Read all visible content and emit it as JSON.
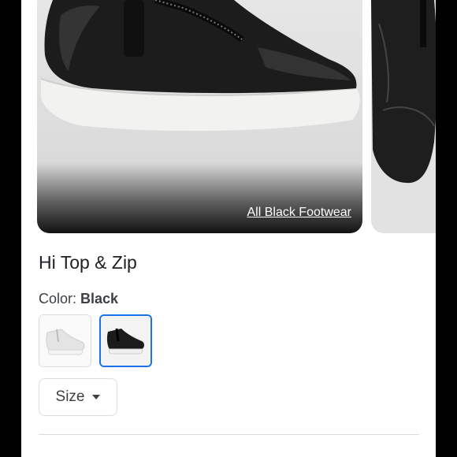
{
  "hero": {
    "link_text": "All Black Footwear",
    "link_icon": "none"
  },
  "product": {
    "title": "Hi Top & Zip",
    "color_label": "Color:",
    "color_value": "Black",
    "swatches": [
      {
        "name": "White",
        "icon": "white-sneaker-thumbnail",
        "selected": false
      },
      {
        "name": "Black",
        "icon": "black-sneaker-thumbnail",
        "selected": true
      }
    ]
  },
  "size_button": {
    "label": "Size"
  },
  "colors": {
    "accent": "#1a73e8",
    "text": "#202124",
    "border": "#dadce0"
  }
}
